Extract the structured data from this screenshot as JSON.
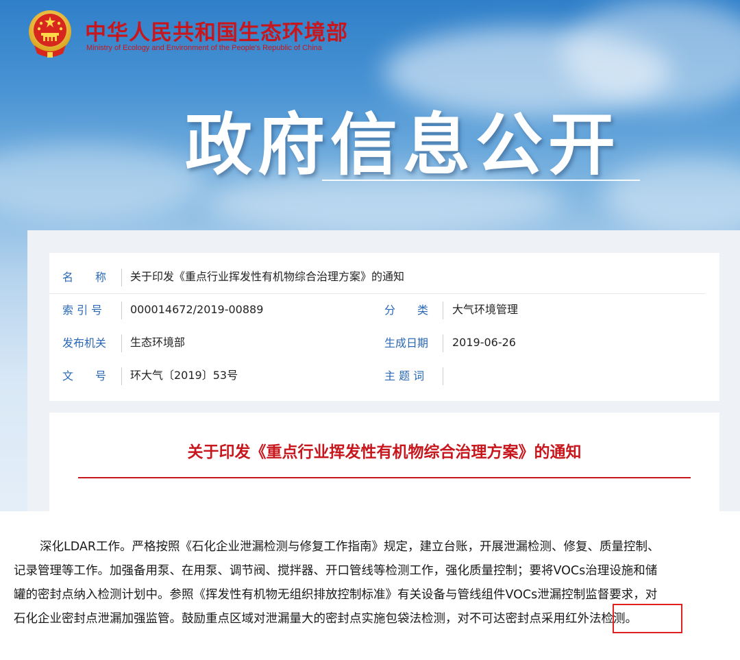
{
  "header": {
    "site_title_cn": "中华人民共和国生态环境部",
    "site_title_en": "Ministry of Ecology and Environment of the People's Republic of China",
    "hero_title": "政府信息公开",
    "emblem_icon": "national-emblem-icon"
  },
  "meta": {
    "name_label": "名　　称",
    "name_value": "关于印发《重点行业挥发性有机物综合治理方案》的通知",
    "index_label": "索 引 号",
    "index_value": "000014672/2019-00889",
    "category_label": "分　　类",
    "category_value": "大气环境管理",
    "issuer_label": "发布机关",
    "issuer_value": "生态环境部",
    "date_label": "生成日期",
    "date_value": "2019-06-26",
    "docno_label": "文　　号",
    "docno_value": "环大气〔2019〕53号",
    "keywords_label": "主 题 词",
    "keywords_value": ""
  },
  "document": {
    "title": "关于印发《重点行业挥发性有机物综合治理方案》的通知"
  },
  "excerpt": {
    "lines": [
      "深化LDAR工作。严格按照《石化企业泄漏检测与修复工作指南》规定，建立台账，开展泄漏检测、修复、质量控制、",
      "记录管理等工作。加强备用泵、在用泵、调节阀、搅拌器、开口管线等检测工作，强化质量控制；要将VOCs治理设施和储",
      "罐的密封点纳入检测计划中。参照《挥发性有机物无组织排放控制标准》有关设备与管线组件VOCs泄漏控制监督要求，对",
      "石化企业密封点泄漏加强监管。鼓励重点区域对泄漏量大的密封点实施包袋法检测，对不可达密封点采用红外法检测。"
    ]
  },
  "colors": {
    "brand_red": "#c8161d",
    "label_blue": "#2a68b5",
    "highlight_red": "#e02020"
  }
}
